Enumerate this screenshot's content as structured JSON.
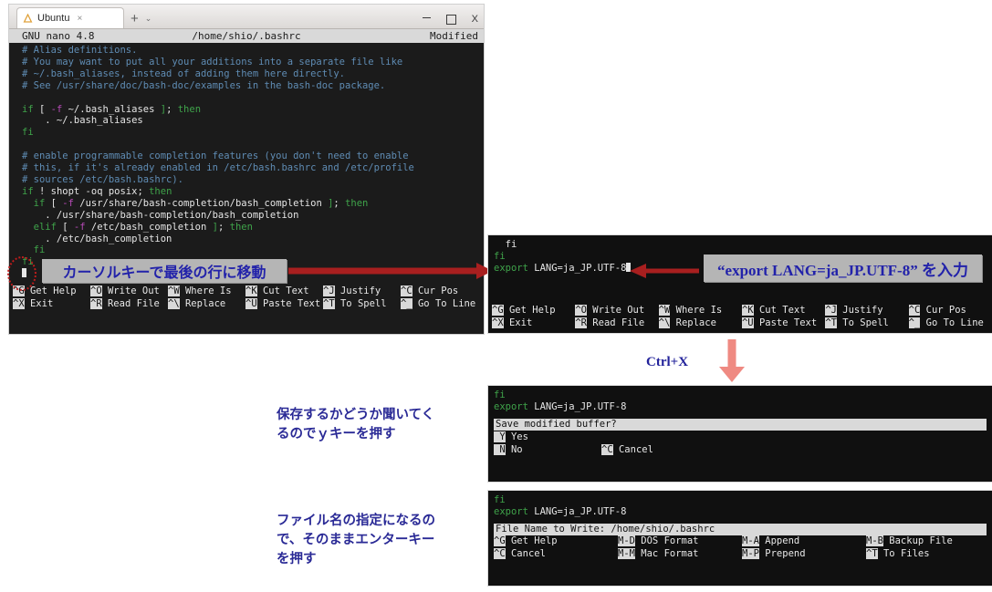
{
  "window": {
    "tab_title": "Ubuntu",
    "tab_close": "×",
    "newtab": "+",
    "chevron": "⌄",
    "close_label": "X",
    "app_icon": "ubuntu-logo"
  },
  "nano": {
    "version": "GNU nano 4.8",
    "filename": "/home/shio/.bashrc",
    "status": "Modified"
  },
  "editor_lines": [
    [
      {
        "t": "# Alias definitions.",
        "c": "cmt"
      }
    ],
    [
      {
        "t": "# You may want to put all your additions into a separate file like",
        "c": "cmt"
      }
    ],
    [
      {
        "t": "# ~/.bash_aliases, instead of adding them here directly.",
        "c": "cmt"
      }
    ],
    [
      {
        "t": "# See /usr/share/doc/bash-doc/examples in the bash-doc package.",
        "c": "cmt"
      }
    ],
    [
      {
        "t": "",
        "c": "pl"
      }
    ],
    [
      {
        "t": "if",
        "c": "kw"
      },
      {
        "t": " [ ",
        "c": "pl"
      },
      {
        "t": "-f",
        "c": "op"
      },
      {
        "t": " ~/.bash_aliases ",
        "c": "pl"
      },
      {
        "t": "]",
        "c": "kw"
      },
      {
        "t": "; ",
        "c": "pl"
      },
      {
        "t": "then",
        "c": "kw"
      }
    ],
    [
      {
        "t": "    . ~/.bash_aliases",
        "c": "pl"
      }
    ],
    [
      {
        "t": "fi",
        "c": "kw"
      }
    ],
    [
      {
        "t": "",
        "c": "pl"
      }
    ],
    [
      {
        "t": "# enable programmable completion features (you don't need to enable",
        "c": "cmt"
      }
    ],
    [
      {
        "t": "# this, if it's already enabled in /etc/bash.bashrc and /etc/profile",
        "c": "cmt"
      }
    ],
    [
      {
        "t": "# sources /etc/bash.bashrc).",
        "c": "cmt"
      }
    ],
    [
      {
        "t": "if",
        "c": "kw"
      },
      {
        "t": " ! shopt -oq posix",
        "c": "pl"
      },
      {
        "t": ";",
        "c": "pl"
      },
      {
        "t": " then",
        "c": "kw"
      }
    ],
    [
      {
        "t": "  ",
        "c": "pl"
      },
      {
        "t": "if",
        "c": "kw"
      },
      {
        "t": " [ ",
        "c": "pl"
      },
      {
        "t": "-f",
        "c": "op"
      },
      {
        "t": " /usr/share/bash-completion/bash_completion ",
        "c": "pl"
      },
      {
        "t": "]",
        "c": "kw"
      },
      {
        "t": "; ",
        "c": "pl"
      },
      {
        "t": "then",
        "c": "kw"
      }
    ],
    [
      {
        "t": "    . /usr/share/bash-completion/bash_completion",
        "c": "pl"
      }
    ],
    [
      {
        "t": "  ",
        "c": "pl"
      },
      {
        "t": "elif",
        "c": "kw"
      },
      {
        "t": " [ ",
        "c": "pl"
      },
      {
        "t": "-f",
        "c": "op"
      },
      {
        "t": " /etc/bash_completion ",
        "c": "pl"
      },
      {
        "t": "]",
        "c": "kw"
      },
      {
        "t": "; ",
        "c": "pl"
      },
      {
        "t": "then",
        "c": "kw"
      }
    ],
    [
      {
        "t": "    . /etc/bash_completion",
        "c": "pl"
      }
    ],
    [
      {
        "t": "  ",
        "c": "pl"
      },
      {
        "t": "fi",
        "c": "kw"
      }
    ],
    [
      {
        "t": "fi",
        "c": "kw"
      }
    ]
  ],
  "shortcut_bar": {
    "row1": [
      {
        "key": "^G",
        "label": "Get Help"
      },
      {
        "key": "^O",
        "label": "Write Out"
      },
      {
        "key": "^W",
        "label": "Where Is"
      },
      {
        "key": "^K",
        "label": "Cut Text"
      },
      {
        "key": "^J",
        "label": "Justify"
      },
      {
        "key": "^C",
        "label": "Cur Pos"
      }
    ],
    "row2": [
      {
        "key": "^X",
        "label": "Exit"
      },
      {
        "key": "^R",
        "label": "Read File"
      },
      {
        "key": "^\\",
        "label": "Replace"
      },
      {
        "key": "^U",
        "label": "Paste Text"
      },
      {
        "key": "^T",
        "label": "To Spell"
      },
      {
        "key": "^_",
        "label": "Go To Line"
      }
    ]
  },
  "panel2": {
    "line1": "  fi",
    "line2": "fi",
    "line3_cmd": "export",
    "line3_rest": " LANG=ja_JP.UTF-8"
  },
  "panel3": {
    "line1": "fi",
    "line2_cmd": "export",
    "line2_rest": " LANG=ja_JP.UTF-8",
    "prompt": "Save modified buffer?",
    "options": [
      {
        "key": " Y",
        "label": " Yes"
      },
      {
        "key": " N",
        "label": " No"
      },
      {
        "key": "^C",
        "label": " Cancel"
      }
    ]
  },
  "panel4": {
    "line1": "fi",
    "line2_cmd": "export",
    "line2_rest": " LANG=ja_JP.UTF-8",
    "prompt": "File Name to Write: /home/shio/.bashrc",
    "row1": [
      {
        "key": "^G",
        "label": "Get Help"
      },
      {
        "key": "M-D",
        "label": "DOS Format"
      },
      {
        "key": "M-A",
        "label": "Append"
      },
      {
        "key": "M-B",
        "label": "Backup File"
      }
    ],
    "row2": [
      {
        "key": "^C",
        "label": "Cancel"
      },
      {
        "key": "M-M",
        "label": "Mac Format"
      },
      {
        "key": "M-P",
        "label": "Prepend"
      },
      {
        "key": "^T",
        "label": "To Files"
      }
    ]
  },
  "annotations": {
    "step1": "カーソルキーで最後の行に移動",
    "step2": "“export LANG=ja_JP.UTF-8” を入力",
    "ctrlx": "Ctrl+X",
    "step3_line1": "保存するかどうか聞いてく",
    "step3_line2": "るのでｙキーを押す",
    "step4_line1": "ファイル名の指定になるの",
    "step4_line2": "で、そのままエンターキー",
    "step4_line3": "を押す"
  },
  "colors": {
    "annotation_text": "#2a2a96",
    "arrow_red": "#a81f1f",
    "arrow_salmon": "#ef8a82",
    "highlight_circle": "#c01c1c",
    "comment": "#5f8cb4",
    "keyword": "#3fa34a"
  }
}
